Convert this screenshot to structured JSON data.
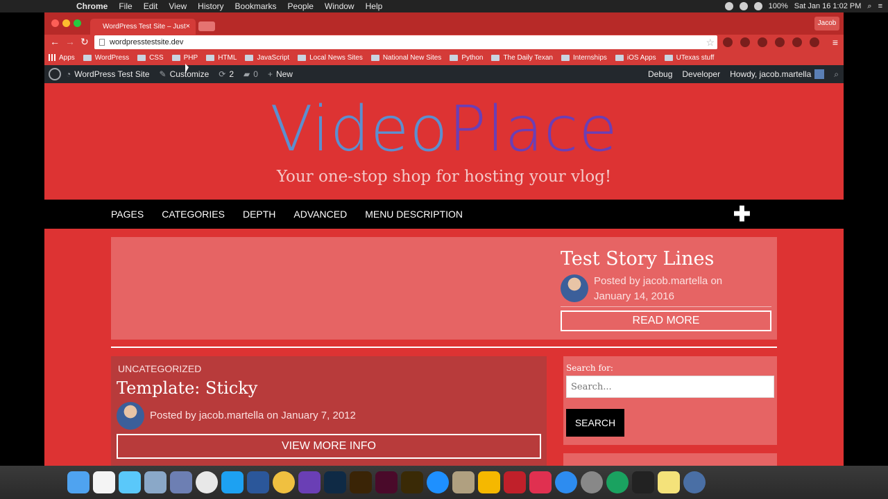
{
  "menubar": {
    "app": "Chrome",
    "items": [
      "File",
      "Edit",
      "View",
      "History",
      "Bookmarks",
      "People",
      "Window",
      "Help"
    ],
    "battery": "100%",
    "datetime": "Sat Jan 16  1:02 PM"
  },
  "browser": {
    "tab_title": "WordPress Test Site – Just",
    "profile": "Jacob",
    "url": "wordpresstestsite.dev",
    "bookmarks": [
      "Apps",
      "WordPress",
      "CSS",
      "PHP",
      "HTML",
      "JavaScript",
      "Local News Sites",
      "National New Sites",
      "Python",
      "The Daily Texan",
      "Internships",
      "iOS Apps",
      "UTexas stuff"
    ]
  },
  "adminbar": {
    "site_name": "WordPress Test Site",
    "customize": "Customize",
    "updates": "2",
    "comments": "0",
    "new": "New",
    "debug": "Debug",
    "developer": "Developer",
    "howdy": "Howdy, jacob.martella"
  },
  "site": {
    "title_part1": "Video",
    "title_part2": "Place",
    "tagline": "Your one-stop shop for hosting your vlog!",
    "nav": [
      "PAGES",
      "CATEGORIES",
      "DEPTH",
      "ADVANCED",
      "MENU DESCRIPTION"
    ],
    "featured": {
      "title": "Test Story Lines",
      "meta_prefix": "Posted by",
      "author": "jacob.martella",
      "meta_on": "on",
      "date": "January 14, 2016",
      "button": "READ MORE"
    },
    "post": {
      "category": "UNCATEGORIZED",
      "title": "Template: Sticky",
      "meta": "Posted by jacob.martella on January 7, 2012",
      "button": "VIEW MORE INFO"
    },
    "search_widget": {
      "label": "Search for:",
      "placeholder": "Search...",
      "button": "SEARCH"
    }
  },
  "colors": {
    "site_bg": "#dd3333",
    "nav_bg": "#000000",
    "title_blue": "#5c8fcf",
    "title_purple": "#6b3fb5"
  }
}
